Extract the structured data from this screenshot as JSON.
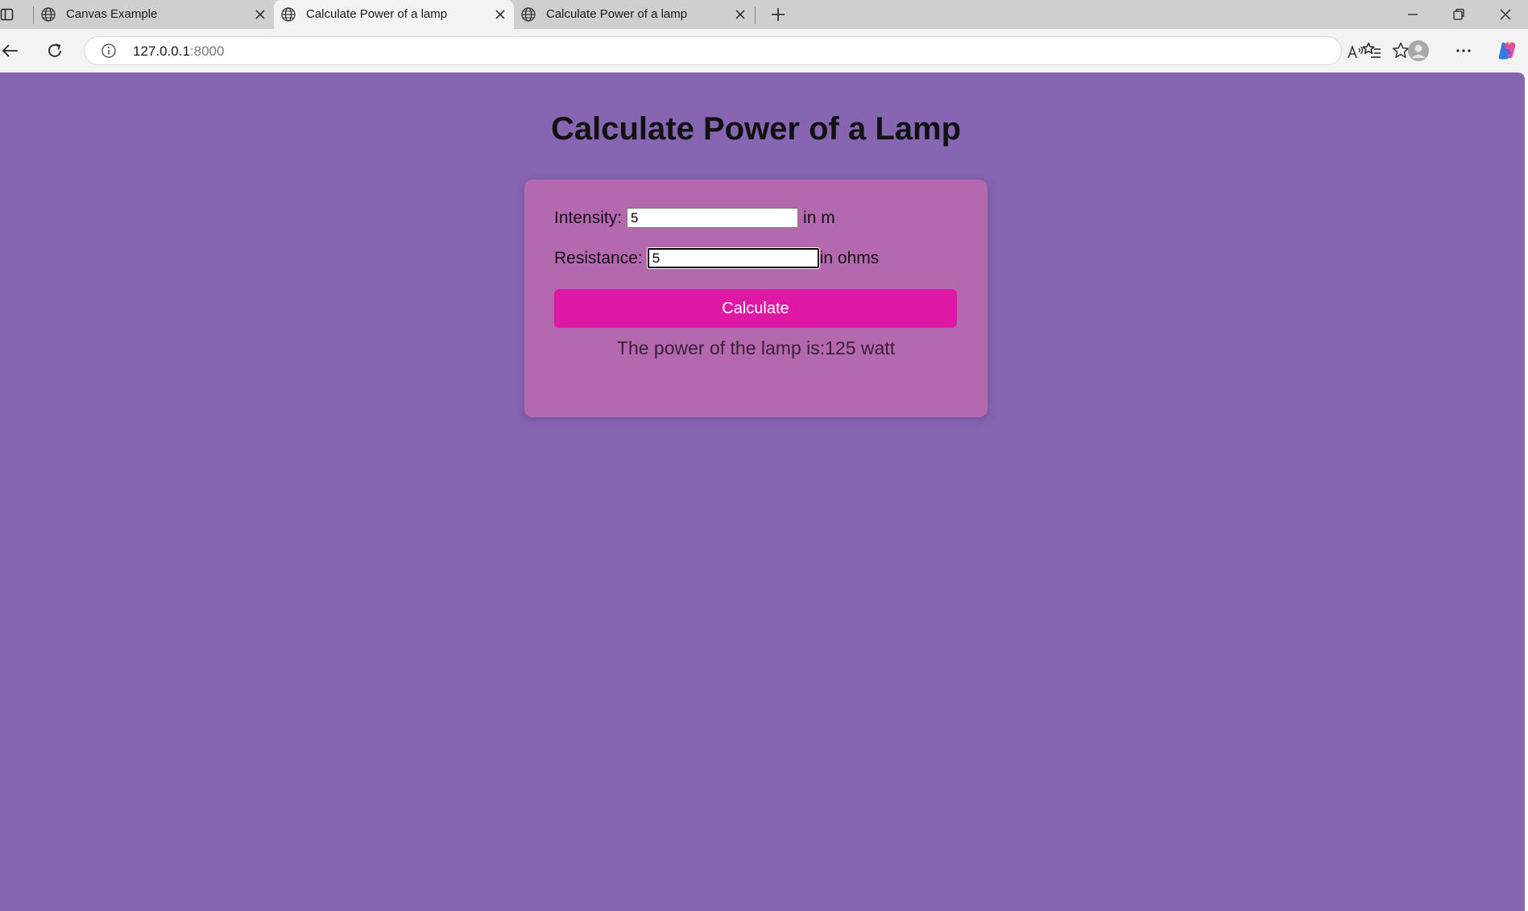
{
  "browser": {
    "tabs": [
      {
        "title": "Canvas Example",
        "active": false
      },
      {
        "title": "Calculate Power of a lamp",
        "active": true
      },
      {
        "title": "Calculate Power of a lamp",
        "active": false
      }
    ],
    "url_host": "127.0.0.1",
    "url_port": ":8000",
    "icons": {
      "sidebar": "sidebar-icon",
      "new_tab": "plus-icon",
      "minimize": "minimize-icon",
      "restore": "restore-icon",
      "close": "close-icon",
      "back": "back-arrow-icon",
      "refresh": "refresh-icon",
      "info": "info-icon",
      "read_aloud": "read-aloud-icon",
      "favorite": "star-icon",
      "favorites": "favorites-list-icon",
      "profile": "profile-avatar-icon",
      "more": "ellipsis-icon",
      "copilot": "copilot-icon"
    }
  },
  "page": {
    "background": "#8666b2",
    "card_background": "#b468ad",
    "accent": "#de17a5",
    "title": "Calculate Power of a Lamp",
    "form": {
      "intensity_label": "Intensity:",
      "intensity_value": "5",
      "intensity_unit": "in m",
      "resistance_label": "Resistance:",
      "resistance_value": "5",
      "resistance_unit": "in ohms",
      "calculate_label": "Calculate"
    },
    "result_text": "The power of the lamp is:125 watt"
  }
}
